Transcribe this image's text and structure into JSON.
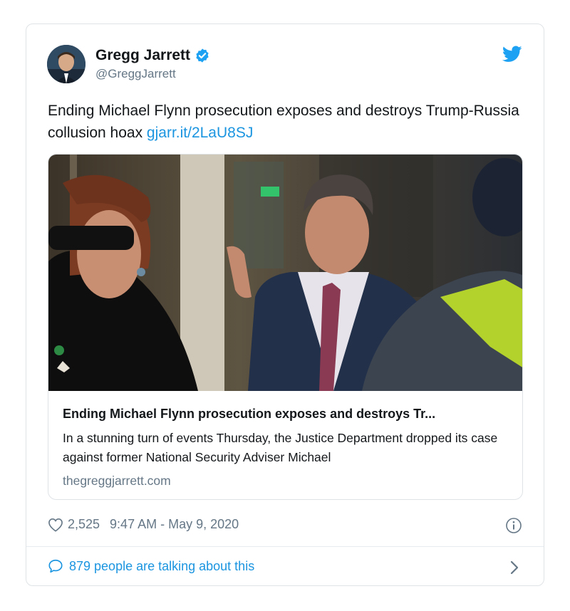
{
  "author": {
    "name": "Gregg Jarrett",
    "handle": "@GreggJarrett",
    "verified_icon": "verified-badge-icon",
    "avatar": "avatar-photo"
  },
  "tweet": {
    "text": "Ending Michael Flynn prosecution exposes and destroys Trump-Russia collusion hoax ",
    "link": "gjarr.it/2LaU8SJ"
  },
  "link_card": {
    "title": "Ending Michael Flynn prosecution exposes and destroys Tr...",
    "description": "In a stunning turn of events Thursday, the Justice Department dropped its case against former National Security Adviser Michael",
    "domain": "thegreggjarrett.com"
  },
  "meta": {
    "likes": "2,525",
    "timestamp": "9:47 AM - May 9, 2020"
  },
  "footer": {
    "talking": "879 people are talking about this"
  },
  "colors": {
    "accent": "#1b95e0",
    "secondary_text": "#657786",
    "border": "#dfe3e6"
  }
}
